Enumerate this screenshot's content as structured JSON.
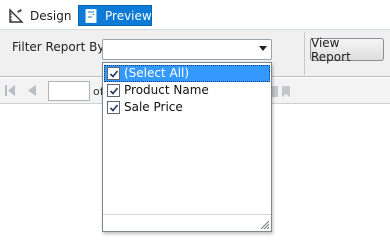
{
  "tabs": {
    "design": {
      "label": "Design",
      "icon": "design-ruler-icon"
    },
    "preview": {
      "label": "Preview",
      "icon": "preview-report-icon",
      "active": true
    }
  },
  "param_bar": {
    "filter_label": "Filter Report By",
    "filter_value": "",
    "view_report_label": "View Report"
  },
  "toolbar": {
    "page_of_label": "of",
    "page_input_value": ""
  },
  "filter_options": [
    {
      "label": "(Select All)",
      "checked": true,
      "selected": true
    },
    {
      "label": "Product Name",
      "checked": true,
      "selected": false
    },
    {
      "label": "Sale Price",
      "checked": true,
      "selected": false
    }
  ],
  "colors": {
    "accent": "#0c7ad6",
    "selection": "#3399ff",
    "panel": "#f0f0f0"
  }
}
